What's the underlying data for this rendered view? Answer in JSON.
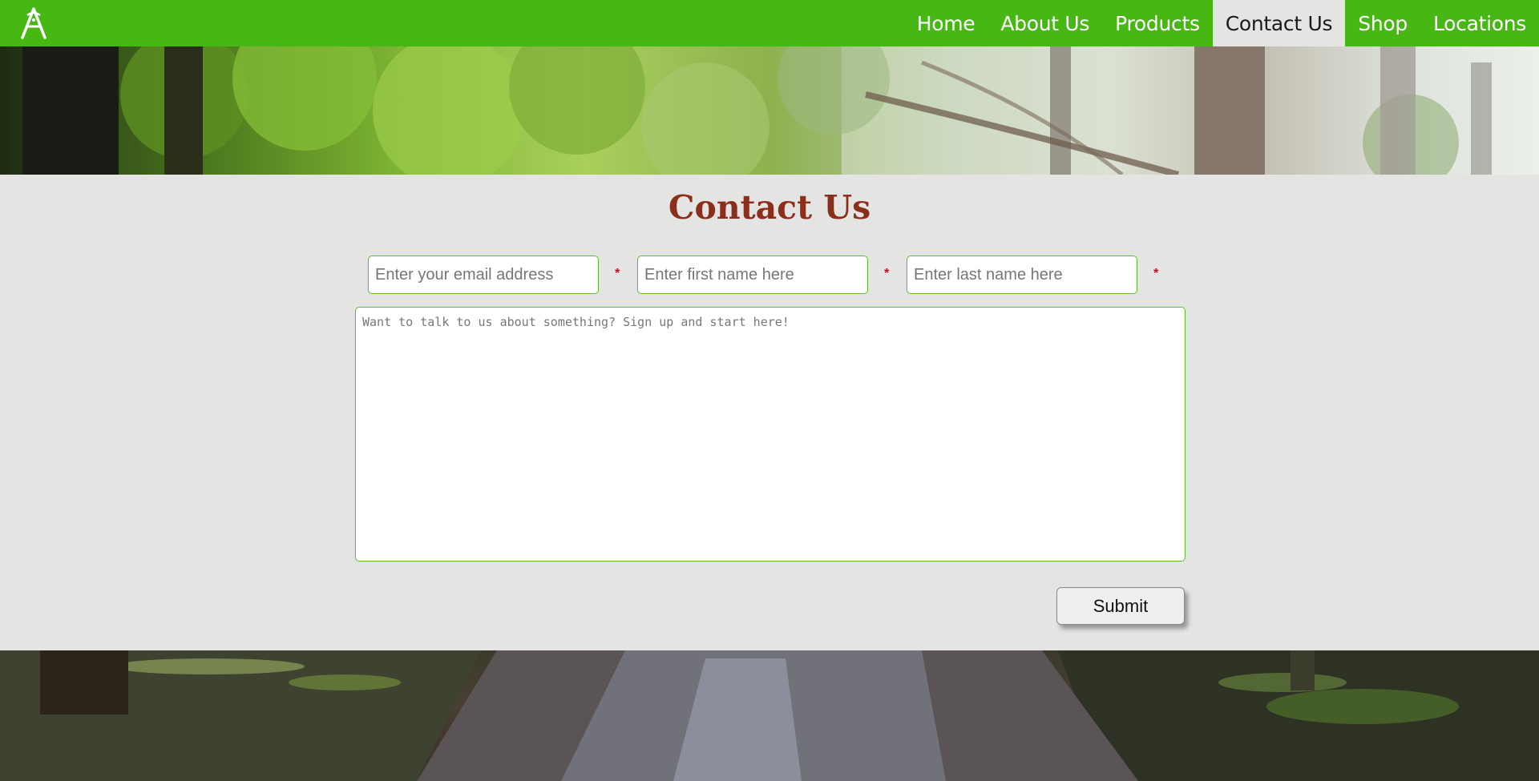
{
  "nav": {
    "logo_icon": "stylized-a-logo-icon",
    "items": [
      {
        "label": "Home",
        "active": false
      },
      {
        "label": "About Us",
        "active": false
      },
      {
        "label": "Products",
        "active": false
      },
      {
        "label": "Contact Us",
        "active": true
      },
      {
        "label": "Shop",
        "active": false
      },
      {
        "label": "Locations",
        "active": false
      }
    ]
  },
  "colors": {
    "nav_bg": "#47b714",
    "title": "#8b2f1c",
    "field_border": "#5dbb2e",
    "required": "#e0001b",
    "page_bg": "#e4e5e3"
  },
  "hero": {
    "image": "forest-canopy-photo"
  },
  "footer": {
    "image": "forest-dirt-path-photo"
  },
  "main": {
    "title": "Contact Us",
    "form": {
      "email": {
        "placeholder": "Enter your email address",
        "value": "",
        "required_mark": "*"
      },
      "first_name": {
        "placeholder": "Enter first name here",
        "value": "",
        "required_mark": "*"
      },
      "last_name": {
        "placeholder": "Enter last name here",
        "value": "",
        "required_mark": "*"
      },
      "message": {
        "placeholder": "Want to talk to us about something? Sign up and start here!",
        "value": ""
      },
      "submit_label": "Submit"
    }
  }
}
